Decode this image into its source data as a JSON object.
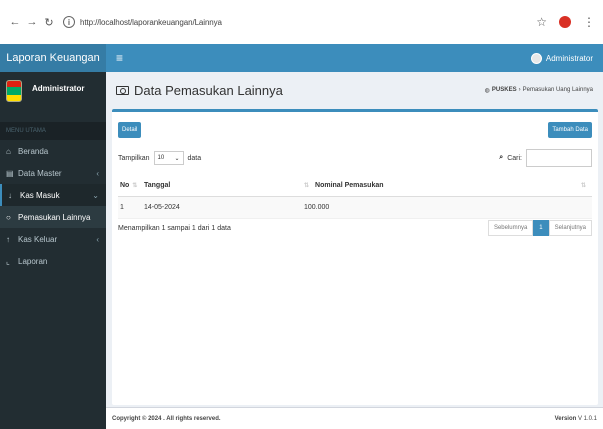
{
  "browser": {
    "url": "http://localhost/laporankeuangan/Lainnya"
  },
  "header": {
    "brand": "Laporan Keuangan",
    "menu_icon": "hamburger-icon",
    "user_label": "Administrator"
  },
  "sidebar": {
    "user_name": "Administrator",
    "menu_header": "MENU UTAMA",
    "items": [
      {
        "label": "Beranda",
        "icon": "home-icon"
      },
      {
        "label": "Data Master",
        "icon": "database-icon"
      },
      {
        "label": "Kas Masuk",
        "icon": "arrow-in-icon"
      },
      {
        "label": "Pemasukan Lainnya",
        "icon": "circle-icon"
      },
      {
        "label": "Kas Keluar",
        "icon": "arrow-out-icon"
      },
      {
        "label": "Laporan",
        "icon": "chart-icon"
      }
    ]
  },
  "content": {
    "title": "Data Pemasukan Lainnya",
    "breadcrumb": {
      "home": "PUSKES",
      "current": "Pemasukan Uang Lainnya"
    }
  },
  "box": {
    "detail_button": "Detail",
    "add_button": "Tambah Data",
    "show_label": "Tampilkan",
    "length_value": "10",
    "entries_label": "data",
    "search_label": "Cari:",
    "search_value": "",
    "columns": [
      "No",
      "Tanggal",
      "Nominal Pemasukan"
    ],
    "rows": [
      {
        "no": "1",
        "tanggal": "14-05-2024",
        "nominal": "100.000"
      }
    ],
    "info": "Menampilkan 1 sampai 1 dari 1 data",
    "pagination": {
      "prev": "Sebelumnya",
      "current": "1",
      "next": "Selanjutnya"
    }
  },
  "footer": {
    "copyright": "Copyright © 2024 . All rights reserved.",
    "version_label": "Version",
    "version_value": "V 1.0.1"
  },
  "colors": {
    "primary": "#3c8dbc",
    "brand_bg": "#357ca5",
    "sidebar_bg": "#222d32"
  }
}
